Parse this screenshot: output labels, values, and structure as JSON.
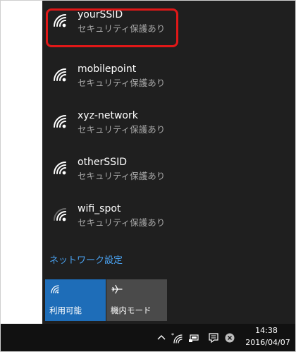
{
  "networks": [
    {
      "ssid": "yourSSID",
      "status": "セキュリティ保護あり",
      "icon": "wifi-secured-icon"
    },
    {
      "ssid": "mobilepoint",
      "status": "セキュリティ保護あり",
      "icon": "wifi-secured-icon"
    },
    {
      "ssid": "xyz-network",
      "status": "セキュリティ保護あり",
      "icon": "wifi-secured-icon"
    },
    {
      "ssid": "otherSSID",
      "status": "セキュリティ保護あり",
      "icon": "wifi-secured-icon"
    },
    {
      "ssid": "wifi_spot",
      "status": "セキュリティ保護あり",
      "icon": "wifi-weak-secured-icon"
    }
  ],
  "settings_link": "ネットワーク設定",
  "tiles": {
    "wifi": {
      "label": "利用可能",
      "icon": "wifi-icon"
    },
    "airplane": {
      "label": "機内モード",
      "icon": "airplane-icon"
    }
  },
  "clock": {
    "time": "14:38",
    "date": "2016/04/07"
  },
  "tray_icons": [
    "chevron-up-icon",
    "wifi-tray-icon",
    "battery-icon",
    "notification-icon",
    "close-circle-icon"
  ],
  "colors": {
    "flyout_bg": "#1f1f1f",
    "highlight": "#e01818",
    "link": "#4aa2f0",
    "tile_active": "#1e6db8",
    "tile_inactive": "#4a4a4a"
  }
}
